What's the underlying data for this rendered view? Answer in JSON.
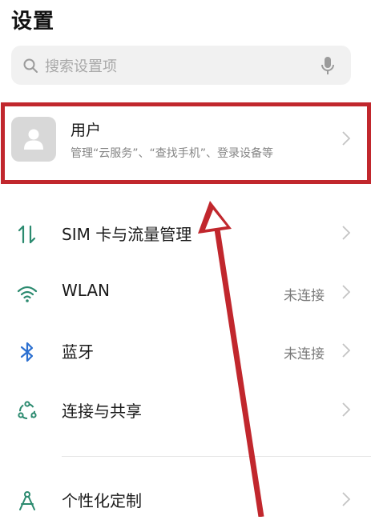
{
  "header": {
    "title": "设置"
  },
  "search": {
    "placeholder": "搜索设置项",
    "icon": "search-icon",
    "mic_icon": "microphone-icon"
  },
  "user_card": {
    "title": "用户",
    "subtitle": "管理“云服务”、“查找手机”、登录设备等",
    "avatar_icon": "person-icon",
    "highlight_color": "#c1272d"
  },
  "settings": {
    "items": [
      {
        "label": "SIM 卡与流量管理",
        "status": "",
        "icon": "data-transfer-icon"
      },
      {
        "label": "WLAN",
        "status": "未连接",
        "icon": "wifi-icon"
      },
      {
        "label": "蓝牙",
        "status": "未连接",
        "icon": "bluetooth-icon"
      },
      {
        "label": "连接与共享",
        "status": "",
        "icon": "share-network-icon"
      },
      {
        "label": "个性化定制",
        "status": "",
        "icon": "personalization-icon"
      }
    ]
  },
  "colors": {
    "accent_icon": "#2b8a6f",
    "annotation": "#c1272d",
    "chevron": "#c4c4c4"
  }
}
